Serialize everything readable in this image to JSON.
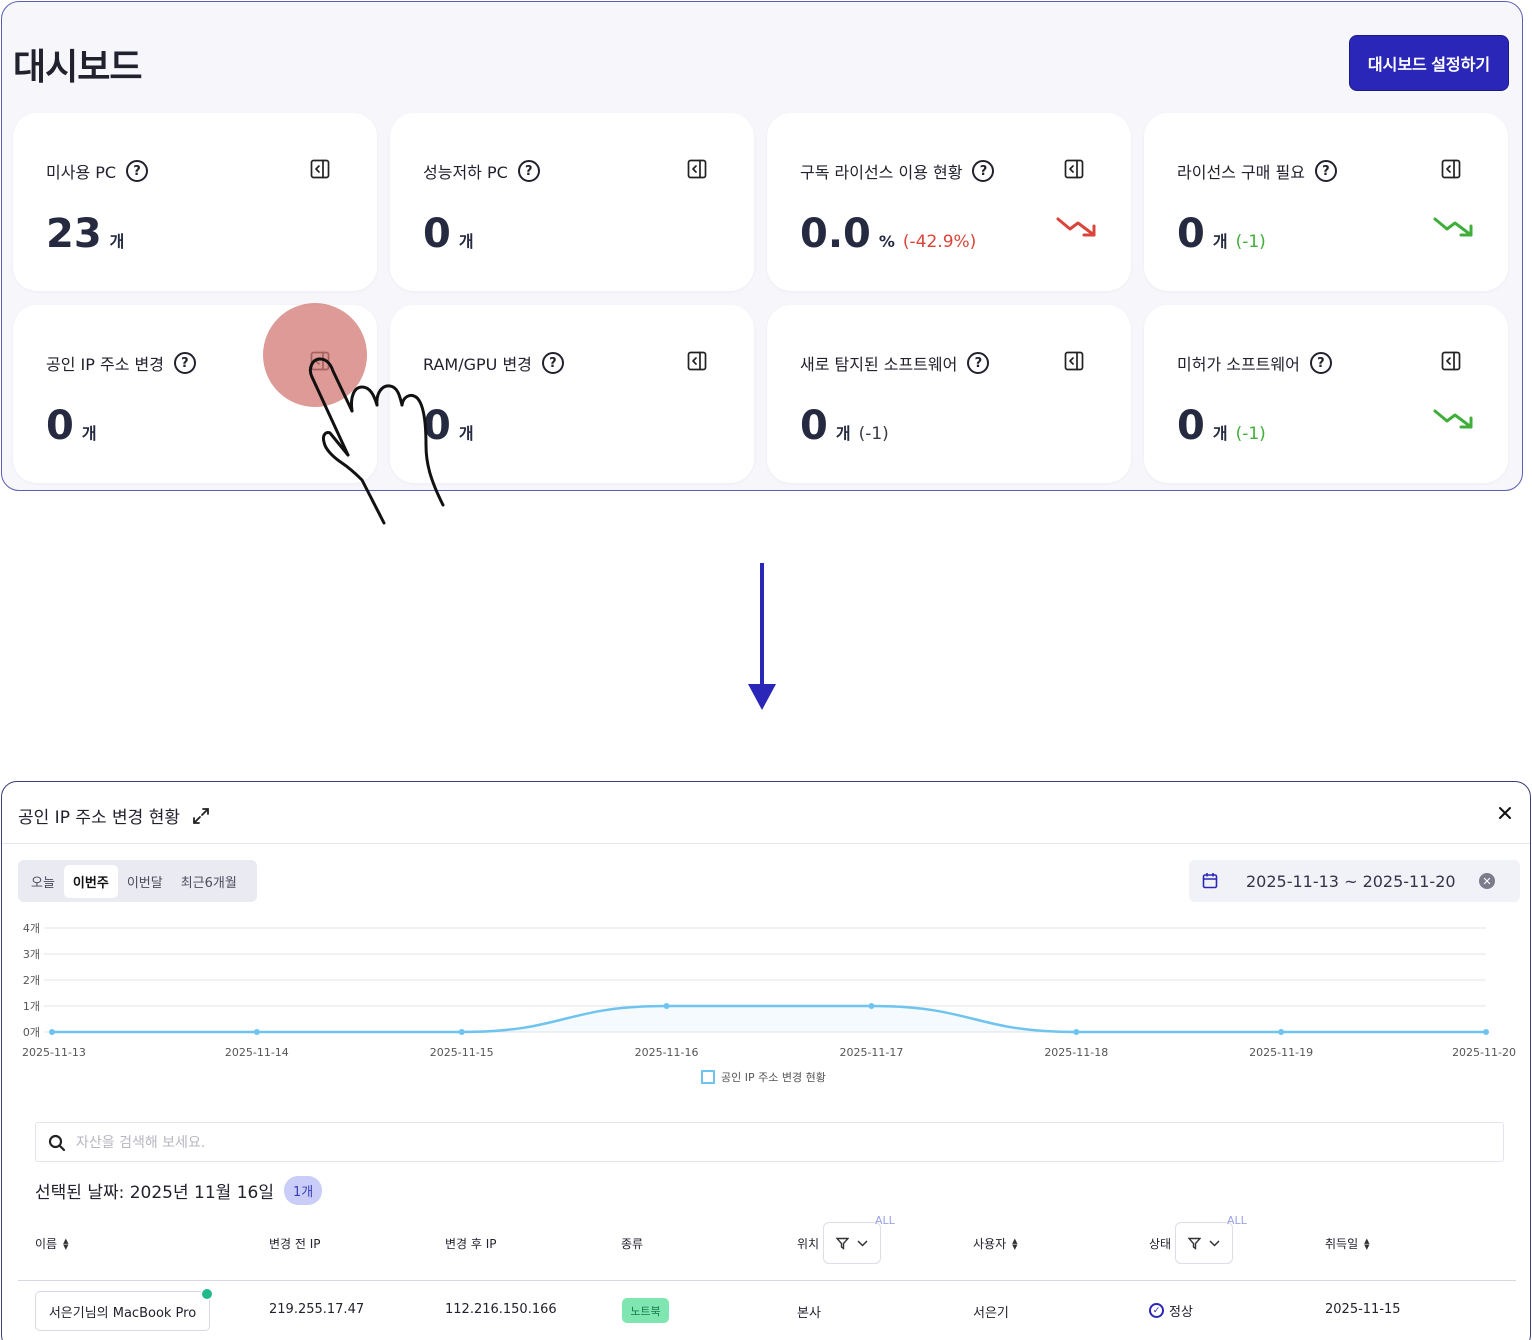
{
  "dashboard": {
    "title": "대시보드",
    "settings_button": "대시보드 설정하기",
    "cards": [
      {
        "label": "미사용 PC",
        "value": "23",
        "unit": "개",
        "delta": "",
        "trend": "none"
      },
      {
        "label": "성능저하 PC",
        "value": "0",
        "unit": "개",
        "delta": "",
        "trend": "none"
      },
      {
        "label": "구독 라이선스 이용 현황",
        "value": "0.0",
        "unit": "%",
        "delta": "(-42.9%)",
        "trend": "down-red"
      },
      {
        "label": "라이선스 구매 필요",
        "value": "0",
        "unit": "개",
        "delta": "(-1)",
        "trend": "down-green"
      },
      {
        "label": "공인 IP 주소 변경",
        "value": "0",
        "unit": "개",
        "delta": "",
        "trend": "none"
      },
      {
        "label": "RAM/GPU 변경",
        "value": "0",
        "unit": "개",
        "delta": "",
        "trend": "none"
      },
      {
        "label": "새로 탐지된 소프트웨어",
        "value": "0",
        "unit": "개",
        "delta": "(-1)",
        "trend": "none"
      },
      {
        "label": "미허가 소프트웨어",
        "value": "0",
        "unit": "개",
        "delta": "(-1)",
        "trend": "down-green"
      }
    ],
    "help_glyph": "?"
  },
  "modal": {
    "title": "공인 IP 주소 변경 현황",
    "close_glyph": "✕",
    "periods": [
      "오늘",
      "이번주",
      "이번달",
      "최근6개월"
    ],
    "active_period": "이번주",
    "date_range": "2025-11-13 ~ 2025-11-20",
    "search_placeholder": "자산을 검색해 보세요.",
    "selected_label": "선택된 날짜: 2025년 11월 16일",
    "selected_count": "1개",
    "columns": {
      "name": "이름",
      "before_ip": "변경 전 IP",
      "after_ip": "변경 후 IP",
      "type": "종류",
      "location": "위치",
      "user": "사용자",
      "status": "상태",
      "acquired": "취득일"
    },
    "all_badge": "ALL",
    "row": {
      "name": "서은기님의 MacBook Pro",
      "before_ip": "219.255.17.47",
      "after_ip": "112.216.150.166",
      "type": "노트북",
      "location": "본사",
      "user": "서은기",
      "status": "정상",
      "acquired": "2025-11-15"
    }
  },
  "chart_data": {
    "type": "area",
    "title": "",
    "x": [
      "2025-11-13",
      "2025-11-14",
      "2025-11-15",
      "2025-11-16",
      "2025-11-17",
      "2025-11-18",
      "2025-11-19",
      "2025-11-20"
    ],
    "series": [
      {
        "name": "공인 IP 주소 변경 현황",
        "values": [
          0,
          0,
          0,
          1,
          1,
          0,
          0,
          0
        ]
      }
    ],
    "y_ticks": [
      "0개",
      "1개",
      "2개",
      "3개",
      "4개"
    ],
    "ylim": [
      0,
      4
    ],
    "grid": true,
    "legend": "bottom-center",
    "color": "#6ec4ef"
  },
  "colors": {
    "primary": "#2a27b8",
    "down_red": "#d9453a",
    "down_green": "#3fae3a",
    "online": "#20b98b"
  }
}
